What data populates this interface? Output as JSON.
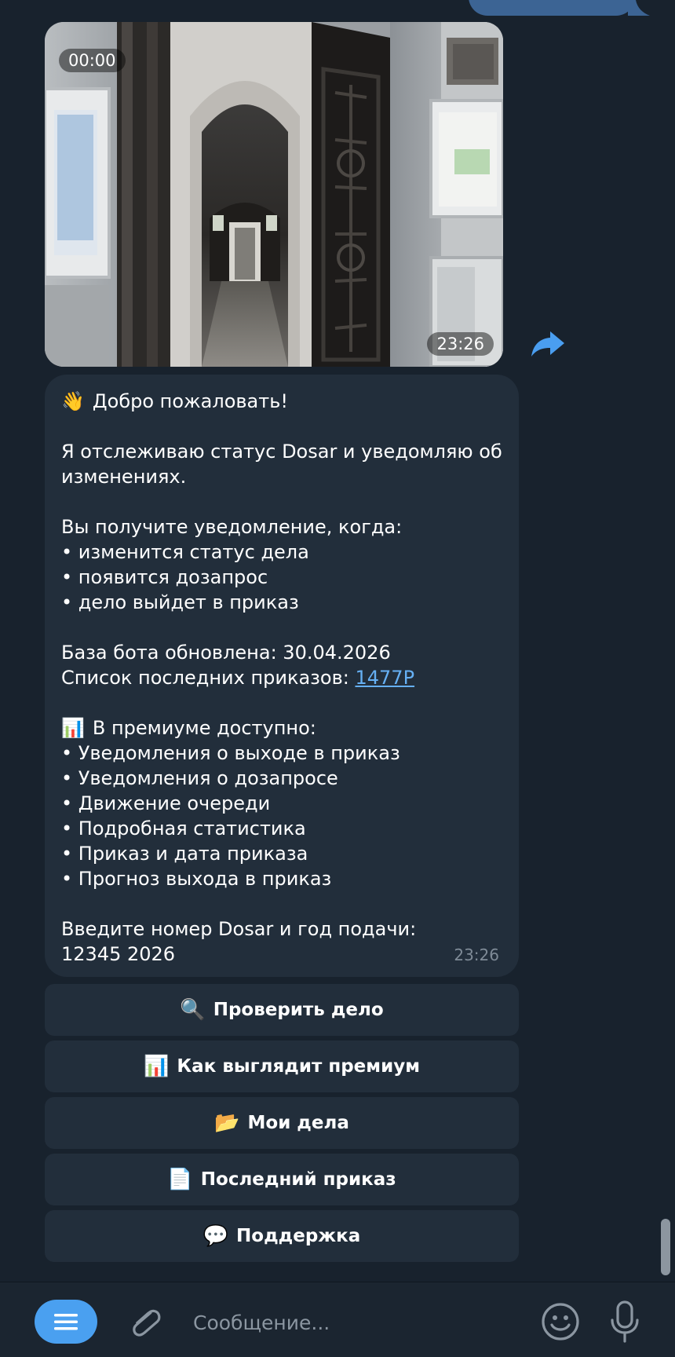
{
  "colors": {
    "background": "#18222d",
    "bubble": "#222e3b",
    "outgoing_bubble": "#3c6494",
    "link": "#66b0f4",
    "accent": "#4aa0f0",
    "muted": "#7f8b97"
  },
  "video": {
    "duration": "00:00",
    "time": "23:26"
  },
  "message": {
    "lines": [
      {
        "emoji": "👋",
        "text": "Добро пожаловать!"
      },
      {
        "text": ""
      },
      {
        "text": "Я отслеживаю статус Dosar и уведомляю об"
      },
      {
        "text": "изменениях."
      },
      {
        "text": ""
      },
      {
        "text": "Вы получите уведомление, когда:"
      },
      {
        "text": "• изменится статус дела"
      },
      {
        "text": "• появится дозапрос"
      },
      {
        "text": "• дело выйдет в приказ"
      },
      {
        "text": ""
      },
      {
        "text": "База бота обновлена: 30.04.2026"
      },
      {
        "text": "Список последних приказов: ",
        "link": "1477P"
      },
      {
        "text": ""
      },
      {
        "emoji": "📊",
        "text": "В премиуме доступно:"
      },
      {
        "text": "• Уведомления о выходе в приказ"
      },
      {
        "text": "• Уведомления о дозапросе"
      },
      {
        "text": "• Движение очереди"
      },
      {
        "text": "• Подробная статистика"
      },
      {
        "text": "• Приказ и дата приказа"
      },
      {
        "text": "• Прогноз выхода в приказ"
      },
      {
        "text": ""
      },
      {
        "text": "Введите номер Dosar и год подачи:"
      },
      {
        "text": "12345 2026"
      }
    ],
    "time": "23:26"
  },
  "keyboard": [
    {
      "icon": "🔍",
      "icon_name": "magnifier-icon",
      "label": "Проверить дело"
    },
    {
      "icon": "📊",
      "icon_name": "chart-icon",
      "label": "Как выглядит премиум"
    },
    {
      "icon": "📂",
      "icon_name": "folder-icon",
      "label": "Мои дела"
    },
    {
      "icon": "📄",
      "icon_name": "document-icon",
      "label": "Последний приказ"
    },
    {
      "icon": "💬",
      "icon_name": "speech-bubble-icon",
      "label": "Поддержка"
    }
  ],
  "composer": {
    "placeholder": "Сообщение..."
  }
}
